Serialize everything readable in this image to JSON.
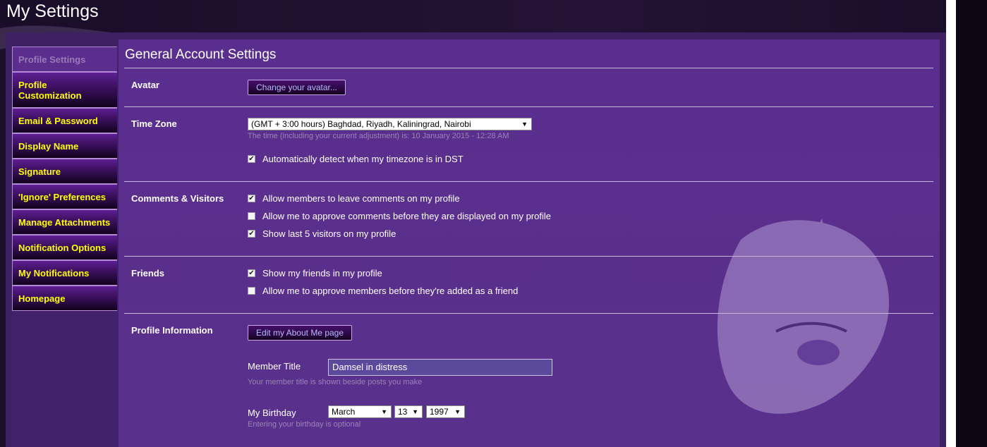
{
  "window": {
    "title": "My Settings"
  },
  "sidebar": {
    "items": [
      {
        "label": "Profile Settings",
        "active": true
      },
      {
        "label": "Profile Customization"
      },
      {
        "label": "Email & Password"
      },
      {
        "label": "Display Name"
      },
      {
        "label": "Signature"
      },
      {
        "label": "'Ignore' Preferences"
      },
      {
        "label": "Manage Attachments"
      },
      {
        "label": "Notification Options"
      },
      {
        "label": "My Notifications"
      },
      {
        "label": "Homepage"
      }
    ]
  },
  "main": {
    "title": "General Account Settings",
    "avatar": {
      "label": "Avatar",
      "button": "Change your avatar..."
    },
    "timezone": {
      "label": "Time Zone",
      "selected": "(GMT + 3:00 hours) Baghdad, Riyadh, Kaliningrad, Nairobi",
      "hint": "The time (including your current adjustment) is: 10 January 2015 - 12:28 AM",
      "dst_label": "Automatically detect when my timezone is in DST",
      "dst_checked": true
    },
    "comments": {
      "label": "Comments & Visitors",
      "options": [
        {
          "label": "Allow members to leave comments on my profile",
          "checked": true
        },
        {
          "label": "Allow me to approve comments before they are displayed on my profile",
          "checked": false
        },
        {
          "label": "Show last 5 visitors on my profile",
          "checked": true
        }
      ]
    },
    "friends": {
      "label": "Friends",
      "options": [
        {
          "label": "Show my friends in my profile",
          "checked": true
        },
        {
          "label": "Allow me to approve members before they're added as a friend",
          "checked": false
        }
      ]
    },
    "profile_info": {
      "label": "Profile Information",
      "button": "Edit my About Me page",
      "member_title_label": "Member Title",
      "member_title_value": "Damsel in distress",
      "member_title_hint": "Your member title is shown beside posts you make",
      "birthday_label": "My Birthday",
      "birthday_month": "March",
      "birthday_day": "13",
      "birthday_year": "1997",
      "birthday_hint": "Entering your birthday is optional"
    }
  },
  "colors": {
    "accent": "#ffff00",
    "panel": "#5a2e8e",
    "hint_text": "#9c83b8"
  },
  "icons": {
    "checkbox_checked": "check-icon",
    "dropdown_arrow": "dropdown-arrow-icon"
  }
}
